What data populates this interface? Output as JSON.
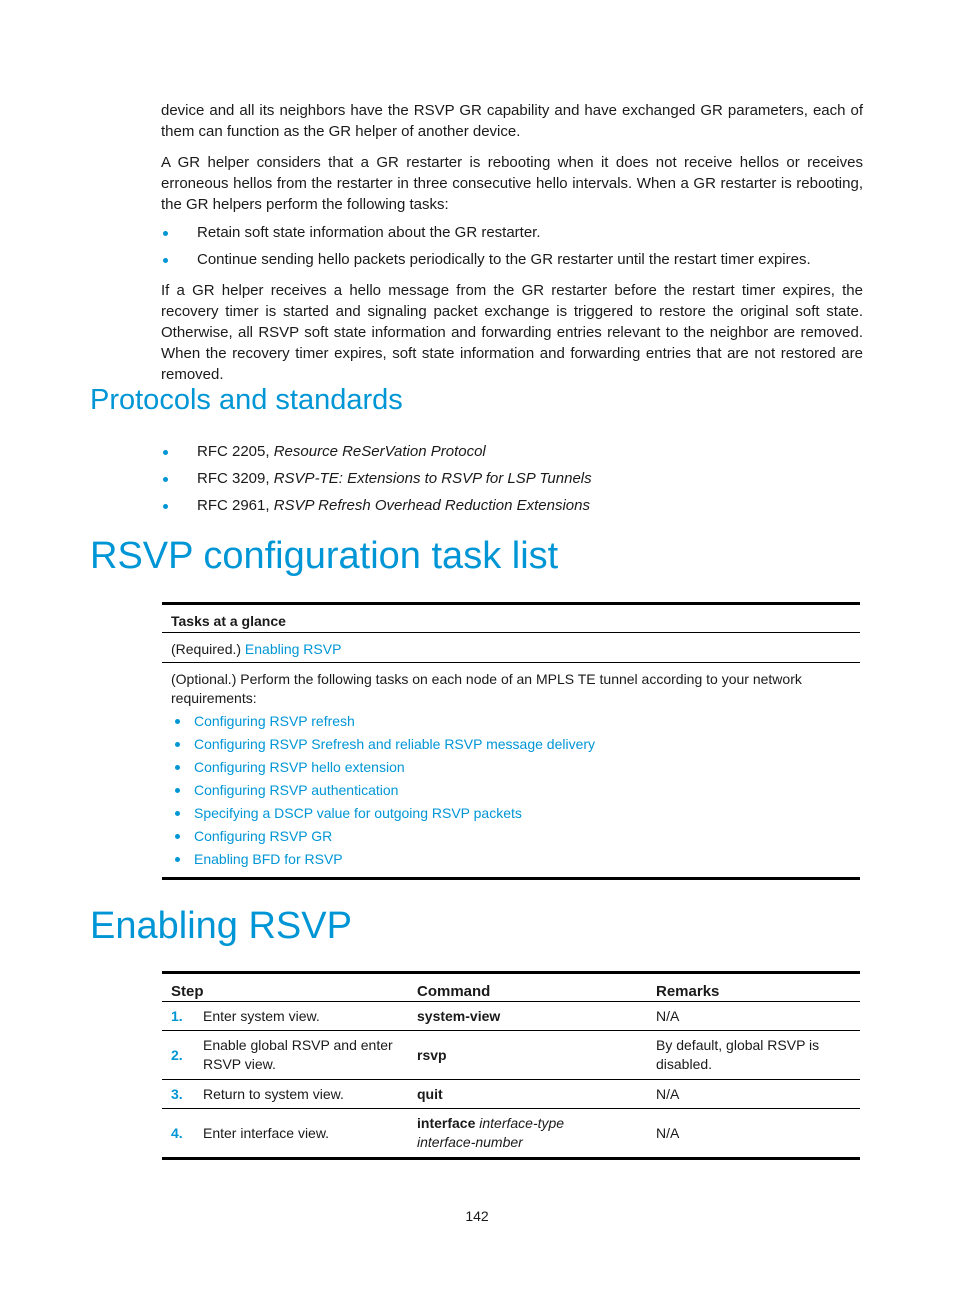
{
  "paragraphs": {
    "intro_cont": "device and all its neighbors have the RSVP GR capability and have exchanged GR parameters, each of them can function as the GR helper of another device.",
    "helper_intro": "A GR helper considers that a GR restarter is rebooting when it does not receive hellos or receives erroneous hellos from the restarter in three consecutive hello intervals. When a GR restarter is rebooting, the GR helpers perform the following tasks:",
    "helper_tasks": [
      "Retain soft state information about the GR restarter.",
      "Continue sending hello packets periodically to the GR restarter until the restart timer expires."
    ],
    "recovery": "If a GR helper receives a hello message from the GR restarter before the restart timer expires, the recovery timer is started and signaling packet exchange is triggered to restore the original soft state. Otherwise, all RSVP soft state information and forwarding entries relevant to the neighbor are removed. When the recovery timer expires, soft state information and forwarding entries that are not restored are removed."
  },
  "protocols": {
    "heading": "Protocols and standards",
    "items": [
      {
        "rfc": "RFC 2205,",
        "title": "Resource ReSerVation Protocol"
      },
      {
        "rfc": "RFC 3209,",
        "title": "RSVP-TE: Extensions to RSVP for LSP Tunnels"
      },
      {
        "rfc": "RFC 2961,",
        "title": "RSVP Refresh Overhead Reduction Extensions"
      }
    ]
  },
  "task_list": {
    "heading": "RSVP configuration task list",
    "table_header": "Tasks at a glance",
    "required_prefix": "(Required.)",
    "required_link": "Enabling RSVP",
    "optional_text": "(Optional.) Perform the following tasks on each node of an MPLS TE tunnel according to your network requirements:",
    "optional_links": [
      "Configuring RSVP refresh",
      "Configuring RSVP Srefresh and reliable RSVP message delivery",
      "Configuring RSVP hello extension",
      "Configuring RSVP authentication",
      "Specifying a DSCP value for outgoing RSVP packets",
      "Configuring RSVP GR",
      "Enabling BFD for RSVP"
    ]
  },
  "enabling": {
    "heading": "Enabling RSVP",
    "columns": [
      "Step",
      "Command",
      "Remarks"
    ],
    "rows": [
      {
        "num": "1.",
        "step": "Enter system view.",
        "cmd_bold": "system-view",
        "cmd_italic": "",
        "remarks": "N/A"
      },
      {
        "num": "2.",
        "step": "Enable global RSVP and enter RSVP view.",
        "cmd_bold": "rsvp",
        "cmd_italic": "",
        "remarks": "By default, global RSVP is disabled."
      },
      {
        "num": "3.",
        "step": "Return to system view.",
        "cmd_bold": "quit",
        "cmd_italic": "",
        "remarks": "N/A"
      },
      {
        "num": "4.",
        "step": "Enter interface view.",
        "cmd_bold": "interface",
        "cmd_italic": "interface-type interface-number",
        "remarks": "N/A"
      }
    ]
  },
  "page_number": "142",
  "colors": {
    "accent": "#0096d6",
    "text": "#1a1a1a"
  }
}
